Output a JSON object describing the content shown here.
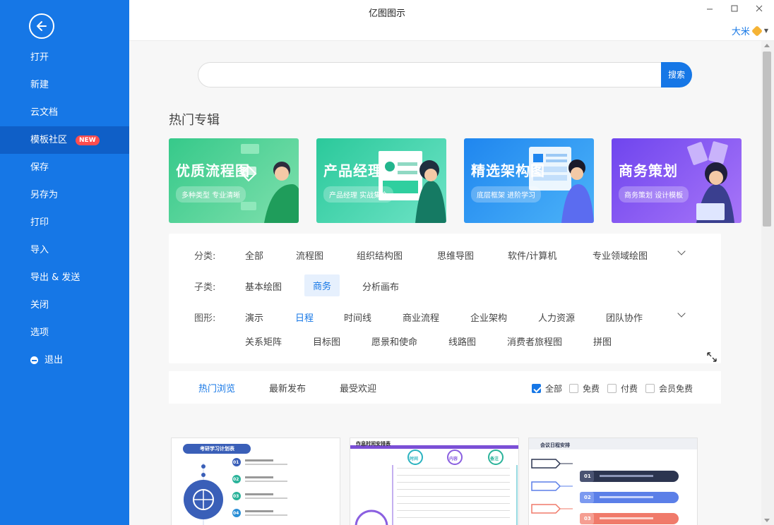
{
  "app": {
    "title": "亿图图示",
    "user_name": "大米"
  },
  "sidebar": {
    "items": [
      {
        "label": "打开"
      },
      {
        "label": "新建"
      },
      {
        "label": "云文档"
      },
      {
        "label": "模板社区",
        "badge": "NEW",
        "active": true
      },
      {
        "label": "保存"
      },
      {
        "label": "另存为"
      },
      {
        "label": "打印"
      },
      {
        "label": "导入"
      },
      {
        "label": "导出 & 发送"
      },
      {
        "label": "关闭"
      },
      {
        "label": "选项"
      },
      {
        "label": "退出",
        "icon": "exit-icon"
      }
    ]
  },
  "search": {
    "placeholder": "",
    "button_label": "搜索"
  },
  "hot_section": {
    "title": "热门专辑",
    "banners": [
      {
        "title": "优质流程图",
        "subtitle": "多种类型 专业清晰",
        "color_from": "#3ccf8e",
        "color_to": "#6fe0a8"
      },
      {
        "title": "产品经理",
        "subtitle": "产品经理 实战集合",
        "color_from": "#2fcf9f",
        "color_to": "#5ee0c0"
      },
      {
        "title": "精选架构图",
        "subtitle": "底层框架 进阶学习",
        "color_from": "#2a8ff0",
        "color_to": "#4fb2f7"
      },
      {
        "title": "商务策划",
        "subtitle": "商务策划 设计模板",
        "color_from": "#7b4ff0",
        "color_to": "#a36ff7"
      }
    ]
  },
  "filters": {
    "category_label": "分类:",
    "categories": [
      "全部",
      "流程图",
      "组织结构图",
      "思维导图",
      "软件/计算机",
      "专业领域绘图"
    ],
    "subcategory_label": "子类:",
    "subcategories": [
      "基本绘图",
      "商务",
      "分析画布"
    ],
    "selected_subcategory": "商务",
    "shape_label": "图形:",
    "shapes_row1": [
      "演示",
      "日程",
      "时间线",
      "商业流程",
      "企业架构",
      "人力资源",
      "团队协作"
    ],
    "shapes_row2": [
      "关系矩阵",
      "目标图",
      "愿景和使命",
      "线路图",
      "消费者旅程图",
      "拼图"
    ],
    "selected_shape": "日程"
  },
  "sort": {
    "tabs": [
      "热门浏览",
      "最新发布",
      "最受欢迎"
    ],
    "active_tab": "热门浏览",
    "checks": [
      {
        "label": "全部",
        "checked": true
      },
      {
        "label": "免费",
        "checked": false
      },
      {
        "label": "付费",
        "checked": false
      },
      {
        "label": "会员免费",
        "checked": false
      }
    ]
  },
  "templates": [
    {
      "title": "考研学习计划表",
      "rows": [
        "01",
        "02",
        "03",
        "04"
      ]
    },
    {
      "title": "作息时间安排表",
      "columns": [
        "时间",
        "内容",
        "备注"
      ]
    },
    {
      "title": "会议日程安排",
      "rows": [
        "01",
        "02",
        "03"
      ]
    }
  ],
  "colors": {
    "sidebar": "#1677e6",
    "accent": "#1677e6",
    "badge": "#ff4d4f"
  }
}
